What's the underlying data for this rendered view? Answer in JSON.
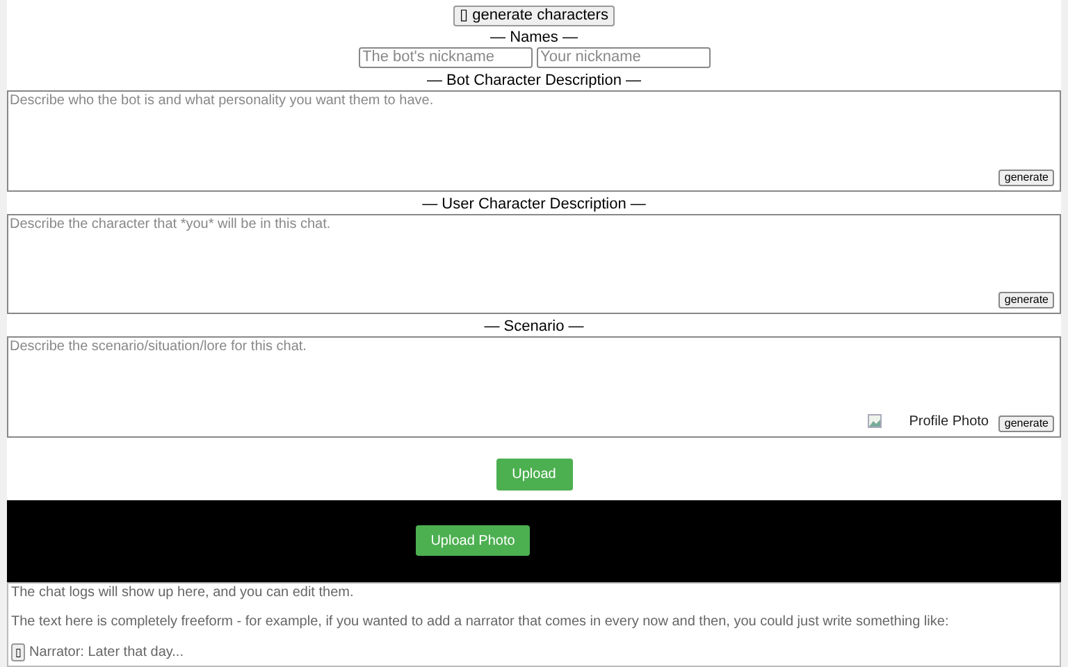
{
  "generate_characters_button": {
    "icon": "▯",
    "label": "generate characters"
  },
  "names": {
    "heading": "— Names —",
    "bot_nickname": {
      "placeholder": "The bot's nickname"
    },
    "user_nickname": {
      "placeholder": "Your nickname"
    }
  },
  "sections": [
    {
      "heading": "— Bot Character Description —",
      "placeholder": "Describe who the bot is and what personality you want them to have.",
      "button": "generate"
    },
    {
      "heading": "— User Character Description —",
      "placeholder": "Describe the character that *you* will be in this chat.",
      "button": "generate"
    },
    {
      "heading": "— Scenario —",
      "placeholder": "Describe the scenario/situation/lore for this chat.",
      "button": "generate",
      "image_alt": "Profile Photo"
    }
  ],
  "upload_button": "Upload",
  "upload_photo_button": "Upload Photo",
  "chat_log": {
    "lines": [
      "The chat logs will show up here, and you can edit them.",
      "The text here is completely freeform - for example, if you wanted to add a narrator that comes in every now and then, you could just write something like:",
      "Narrator: Later that day..."
    ],
    "small_button": "▯"
  }
}
